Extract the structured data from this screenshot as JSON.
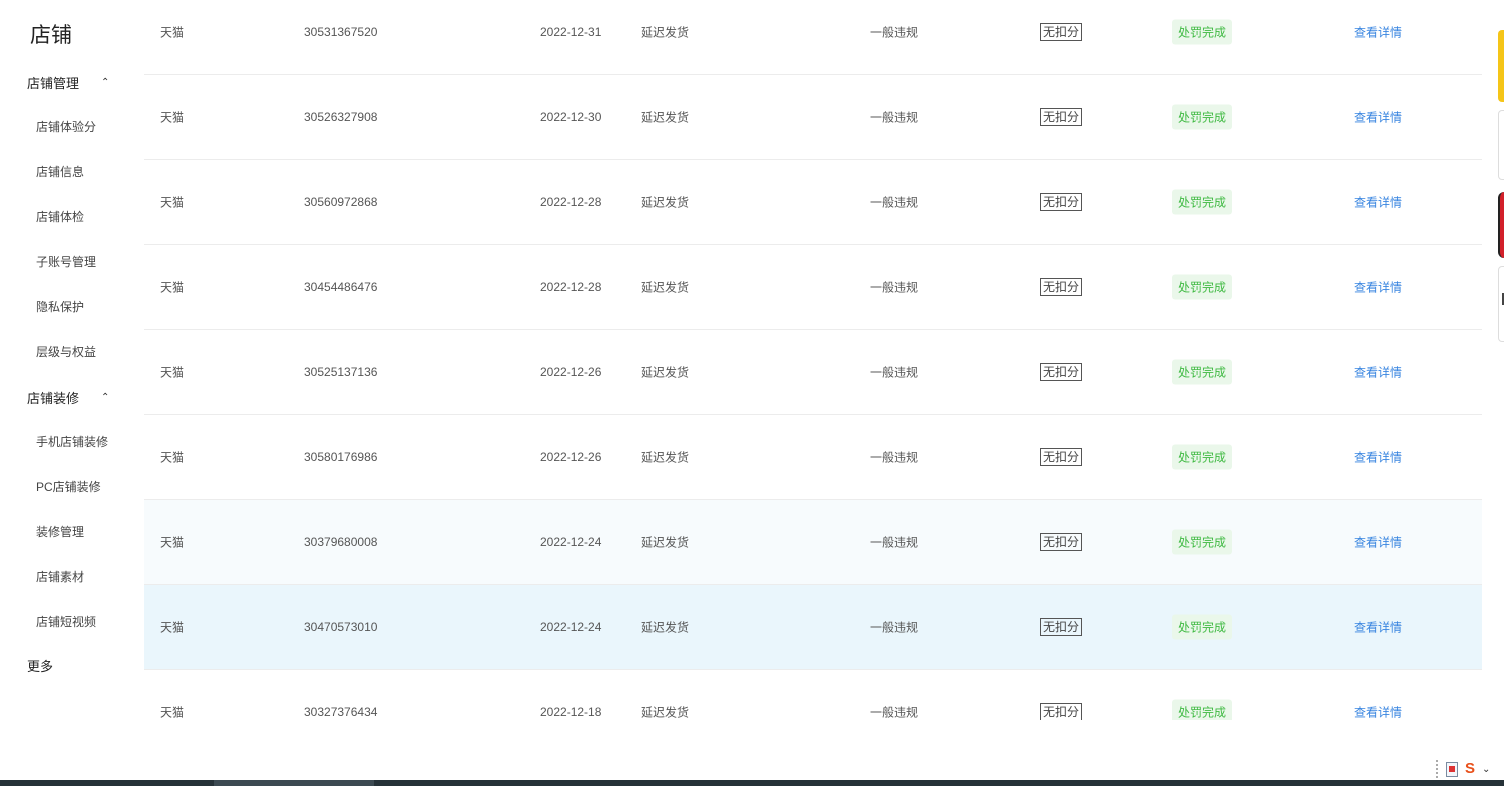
{
  "sidebar": {
    "title": "店铺",
    "sections": [
      {
        "label": "店铺管理",
        "items": [
          "店铺体验分",
          "店铺信息",
          "店铺体检",
          "子账号管理",
          "隐私保护",
          "层级与权益"
        ]
      },
      {
        "label": "店铺装修",
        "items": [
          "手机店铺装修",
          "PC店铺装修",
          "装修管理",
          "店铺素材",
          "店铺短视频"
        ]
      }
    ],
    "more": "更多"
  },
  "rows": [
    {
      "platform": "天猫",
      "id": "30531367520",
      "date": "2022-12-31",
      "reason": "延迟发货",
      "level": "一般违规",
      "points": "无扣分",
      "status": "处罚完成",
      "action": "查看详情"
    },
    {
      "platform": "天猫",
      "id": "30526327908",
      "date": "2022-12-30",
      "reason": "延迟发货",
      "level": "一般违规",
      "points": "无扣分",
      "status": "处罚完成",
      "action": "查看详情"
    },
    {
      "platform": "天猫",
      "id": "30560972868",
      "date": "2022-12-28",
      "reason": "延迟发货",
      "level": "一般违规",
      "points": "无扣分",
      "status": "处罚完成",
      "action": "查看详情"
    },
    {
      "platform": "天猫",
      "id": "30454486476",
      "date": "2022-12-28",
      "reason": "延迟发货",
      "level": "一般违规",
      "points": "无扣分",
      "status": "处罚完成",
      "action": "查看详情"
    },
    {
      "platform": "天猫",
      "id": "30525137136",
      "date": "2022-12-26",
      "reason": "延迟发货",
      "level": "一般违规",
      "points": "无扣分",
      "status": "处罚完成",
      "action": "查看详情"
    },
    {
      "platform": "天猫",
      "id": "30580176986",
      "date": "2022-12-26",
      "reason": "延迟发货",
      "level": "一般违规",
      "points": "无扣分",
      "status": "处罚完成",
      "action": "查看详情"
    },
    {
      "platform": "天猫",
      "id": "30379680008",
      "date": "2022-12-24",
      "reason": "延迟发货",
      "level": "一般违规",
      "points": "无扣分",
      "status": "处罚完成",
      "action": "查看详情"
    },
    {
      "platform": "天猫",
      "id": "30470573010",
      "date": "2022-12-24",
      "reason": "延迟发货",
      "level": "一般违规",
      "points": "无扣分",
      "status": "处罚完成",
      "action": "查看详情"
    },
    {
      "platform": "天猫",
      "id": "30327376434",
      "date": "2022-12-18",
      "reason": "延迟发货",
      "level": "一般违规",
      "points": "无扣分",
      "status": "处罚完成",
      "action": "查看详情"
    }
  ],
  "icons": {
    "section_caret": "chevron-up-icon",
    "tray_1": "document-icon",
    "tray_2": "sogou-s-icon",
    "tray_3": "chevron-down-icon"
  },
  "glyphs": {
    "caret": "⌃",
    "tray_s": "S",
    "tray_chev": "⌄"
  },
  "colors": {
    "link": "#3a86e0",
    "status_text": "#3fba42",
    "status_bg": "#eaf7ea",
    "row_hover": "#eaf6fc"
  }
}
